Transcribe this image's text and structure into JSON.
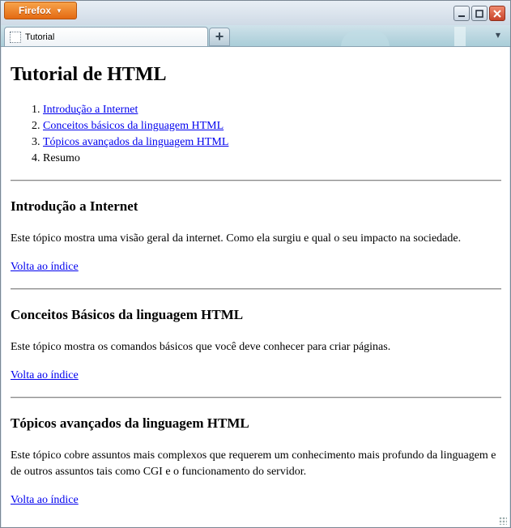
{
  "browser": {
    "app_button_label": "Firefox",
    "tab_title": "Tutorial",
    "new_tab_symbol": "+",
    "accent_color": "#e46a12"
  },
  "page": {
    "title": "Tutorial de HTML",
    "toc": [
      {
        "label": "Introdução a Internet",
        "link": true
      },
      {
        "label": "Conceitos básicos da linguagem HTML",
        "link": true
      },
      {
        "label": "Tópicos avançados da linguagem HTML",
        "link": true
      },
      {
        "label": "Resumo",
        "link": false
      }
    ],
    "sections": [
      {
        "heading": "Introdução a Internet",
        "text": "Este tópico mostra uma visão geral da internet. Como ela surgiu e qual o seu impacto na sociedade.",
        "back_link": "Volta ao índice"
      },
      {
        "heading": "Conceitos Básicos da linguagem HTML",
        "text": "Este tópico mostra os comandos básicos que você deve conhecer para criar páginas.",
        "back_link": "Volta ao índice"
      },
      {
        "heading": "Tópicos avançados da linguagem HTML",
        "text": "Este tópico cobre assuntos mais complexos que requerem um conhecimento mais profundo da linguagem e de outros assuntos tais como CGI e o funcionamento do servidor.",
        "back_link": "Volta ao índice"
      }
    ]
  }
}
